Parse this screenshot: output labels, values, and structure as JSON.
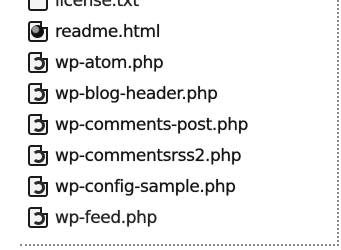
{
  "files": [
    {
      "name": "license.txt",
      "icon": "text-file-icon"
    },
    {
      "name": "readme.html",
      "icon": "html-file-icon"
    },
    {
      "name": "wp-atom.php",
      "icon": "php-file-icon"
    },
    {
      "name": "wp-blog-header.php",
      "icon": "php-file-icon"
    },
    {
      "name": "wp-comments-post.php",
      "icon": "php-file-icon"
    },
    {
      "name": "wp-commentsrss2.php",
      "icon": "php-file-icon"
    },
    {
      "name": "wp-config-sample.php",
      "icon": "php-file-icon"
    },
    {
      "name": "wp-feed.php",
      "icon": "php-file-icon"
    }
  ]
}
